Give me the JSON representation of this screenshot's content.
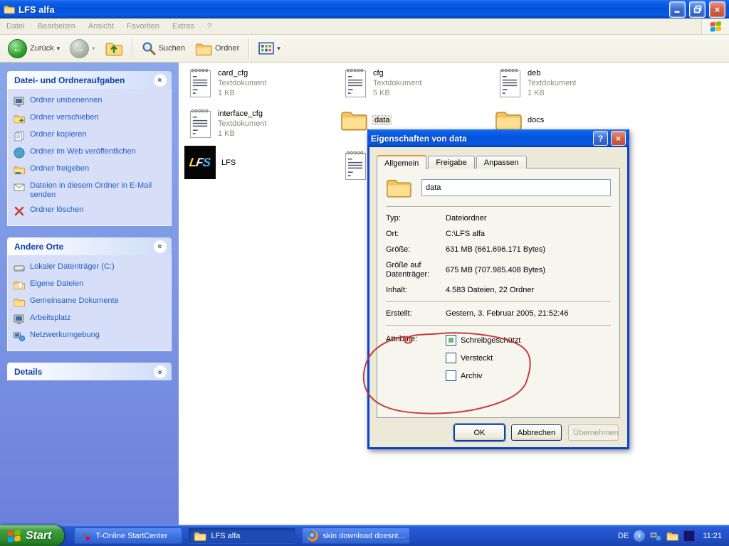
{
  "window": {
    "title": "LFS alfa"
  },
  "menu": {
    "items": [
      "Datei",
      "Bearbeiten",
      "Ansicht",
      "Favoriten",
      "Extras",
      "?"
    ]
  },
  "toolbar": {
    "back_label": "Zurück",
    "search_label": "Suchen",
    "folders_label": "Ordner"
  },
  "sidebar": {
    "tasks": {
      "title": "Datei- und Ordneraufgaben",
      "items": [
        "Ordner umbenennen",
        "Ordner verschieben",
        "Ordner kopieren",
        "Ordner im Web veröffentlichen",
        "Ordner freigeben",
        "Dateien in diesem Ordner in E-Mail senden",
        "Ordner löschen"
      ]
    },
    "places": {
      "title": "Andere Orte",
      "items": [
        "Lokaler Datenträger (C:)",
        "Eigene Dateien",
        "Gemeinsame Dokumente",
        "Arbeitsplatz",
        "Netzwerkumgebung"
      ]
    },
    "details": {
      "title": "Details"
    }
  },
  "files": [
    {
      "name": "card_cfg",
      "type": "Textdokument",
      "size": "1 KB"
    },
    {
      "name": "cfg",
      "type": "Textdokument",
      "size": "5 KB"
    },
    {
      "name": "deb",
      "type": "Textdokument",
      "size": "1 KB"
    },
    {
      "name": "interface_cfg",
      "type": "Textdokument",
      "size": "1 KB"
    },
    {
      "name": "data"
    },
    {
      "name": "docs"
    },
    {
      "name": "LFS"
    }
  ],
  "dialog": {
    "title": "Eigenschaften von data",
    "tabs": [
      "Allgemein",
      "Freigabe",
      "Anpassen"
    ],
    "name_value": "data",
    "rows": [
      {
        "label": "Typ:",
        "value": "Dateiordner"
      },
      {
        "label": "Ort:",
        "value": "C:\\LFS alfa"
      },
      {
        "label": "Größe:",
        "value": "631 MB (661.696.171 Bytes)"
      },
      {
        "label": "Größe auf Datenträger:",
        "value": "675 MB (707.985.408 Bytes)"
      },
      {
        "label": "Inhalt:",
        "value": "4.583 Dateien, 22 Ordner"
      },
      {
        "label": "Erstellt:",
        "value": "Gestern, 3. Februar 2005, 21:52:46"
      }
    ],
    "attributes": {
      "label": "Attribute:",
      "items": [
        {
          "label": "Schreibgeschützt",
          "state": "mixed"
        },
        {
          "label": "Versteckt",
          "state": "off"
        },
        {
          "label": "Archiv",
          "state": "off"
        }
      ]
    },
    "buttons": [
      "OK",
      "Abbrechen",
      "Übernehmen"
    ]
  },
  "taskbar": {
    "start_label": "Start",
    "tasks": [
      "T-Online StartCenter",
      "LFS alfa",
      "skin download doesnt..."
    ],
    "language": "DE",
    "time": "11:21"
  },
  "icons": {
    "close_glyph": "×",
    "help_glyph": "?",
    "dropdown_glyph": "▾",
    "chevron_glyph": "»",
    "back_arrow_glyph": "←",
    "forward_arrow_glyph": "→",
    "tray_chevron_glyph": "‹",
    "lfs_logo_text": "LFS"
  },
  "colors": {
    "titlebar_blue": "#0453dc",
    "taskbar_blue": "#2150c8",
    "start_green": "#2d8a2d",
    "sidebar_link": "#215dc6",
    "annotation_red": "#c83232",
    "checkbox_mixed_green": "#71bb71"
  }
}
